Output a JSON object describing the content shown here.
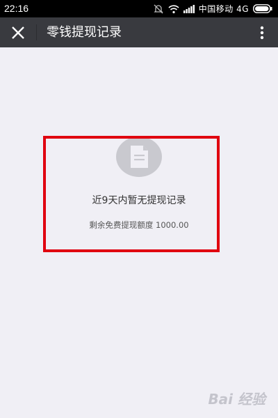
{
  "status_bar": {
    "time": "22:16",
    "carrier": "中国移动 4G",
    "icons": [
      "notifications-off-icon",
      "wifi-icon",
      "signal-icon",
      "battery-icon"
    ]
  },
  "header": {
    "title": "零钱提现记录",
    "back_icon": "close-icon",
    "more_icon": "more-vertical-icon"
  },
  "empty_state": {
    "icon": "document-icon",
    "message": "近9天内暂无提现记录",
    "sub_message": "剩余免费提现额度 1000.00"
  },
  "colors": {
    "titlebar": "#393a3f",
    "background": "#f0eff5",
    "highlight": "#e0000f"
  },
  "watermark": {
    "text": "Bai 经验"
  }
}
